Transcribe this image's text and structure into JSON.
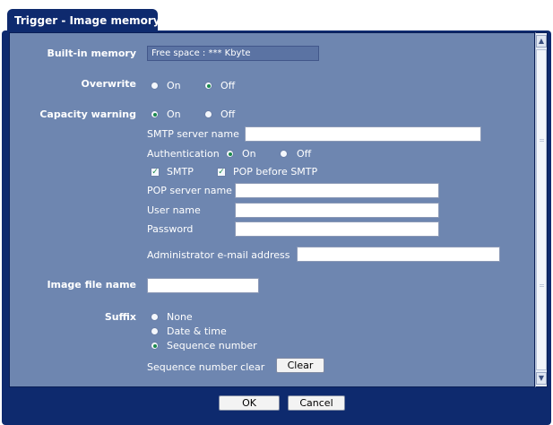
{
  "tab": {
    "title": "Trigger - Image memory"
  },
  "builtin_memory": {
    "label": "Built-in memory",
    "free_space": "Free space : *** Kbyte"
  },
  "overwrite": {
    "label": "Overwrite",
    "options": [
      "On",
      "Off"
    ],
    "selected": "Off"
  },
  "capacity_warning": {
    "label": "Capacity warning",
    "options": [
      "On",
      "Off"
    ],
    "selected": "On",
    "smtp_server_name": {
      "label": "SMTP server name",
      "value": ""
    },
    "authentication": {
      "label": "Authentication",
      "options": [
        "On",
        "Off"
      ],
      "selected": "On"
    },
    "smtp": {
      "label": "SMTP",
      "checked": true
    },
    "pop_before_smtp": {
      "label": "POP before SMTP",
      "checked": true
    },
    "pop_server_name": {
      "label": "POP server name",
      "value": ""
    },
    "user_name": {
      "label": "User name",
      "value": ""
    },
    "password": {
      "label": "Password",
      "value": ""
    },
    "admin_email": {
      "label": "Administrator e-mail address",
      "value": ""
    }
  },
  "image_file_name": {
    "label": "Image file name",
    "value": ""
  },
  "suffix": {
    "label": "Suffix",
    "options": [
      "None",
      "Date & time",
      "Sequence number"
    ],
    "selected": "Sequence number",
    "sequence_clear": {
      "label": "Sequence number clear",
      "button": "Clear"
    }
  },
  "footer": {
    "ok": "OK",
    "cancel": "Cancel"
  }
}
